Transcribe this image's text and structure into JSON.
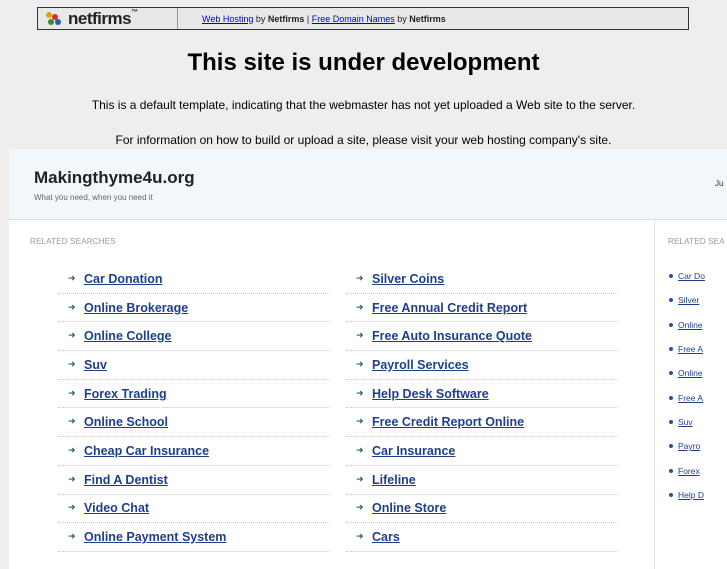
{
  "topbar": {
    "logo_text": "netfirms",
    "logo_tm": "™",
    "link1": "Web Hosting",
    "by1": " by ",
    "brand1": "Netfirms",
    "sep": " | ",
    "link2": "Free Domain Names",
    "by2": " by ",
    "brand2": "Netfirms"
  },
  "headline": "This site is under development",
  "info1": "This is a default template, indicating that the webmaster has not yet uploaded a Web site to the server.",
  "info2": "For information on how to build or upload a site, please visit your web hosting company's site.",
  "site": {
    "title": "Makingthyme4u.org",
    "tagline": "What you need, when you need it",
    "date_fragment": "Ju"
  },
  "left_section_label": "RELATED SEARCHES",
  "right_section_label": "RELATED SEA",
  "col1": [
    "Car Donation",
    "Online Brokerage",
    "Online College",
    "Suv",
    "Forex Trading",
    "Online School",
    "Cheap Car Insurance",
    "Find A Dentist",
    "Video Chat",
    "Online Payment System"
  ],
  "col2": [
    "Silver Coins",
    "Free Annual Credit Report",
    "Free Auto Insurance Quote",
    "Payroll Services",
    "Help Desk Software",
    "Free Credit Report Online",
    "Car Insurance",
    "Lifeline",
    "Online Store",
    "Cars"
  ],
  "right_list": [
    "Car Do",
    "Silver",
    "Online",
    "Free A",
    "Online",
    "Free A",
    "Suv",
    "Payro",
    "Forex",
    "Help D"
  ],
  "icons": {
    "arrow": "arrow-right-icon",
    "bullet": "bullet-dot-icon",
    "logo": "netfirms-logo-icon"
  },
  "colors": {
    "link": "#1e3f8c",
    "header_bg": "#f1f7fa",
    "page_bg": "#eeeeee"
  }
}
